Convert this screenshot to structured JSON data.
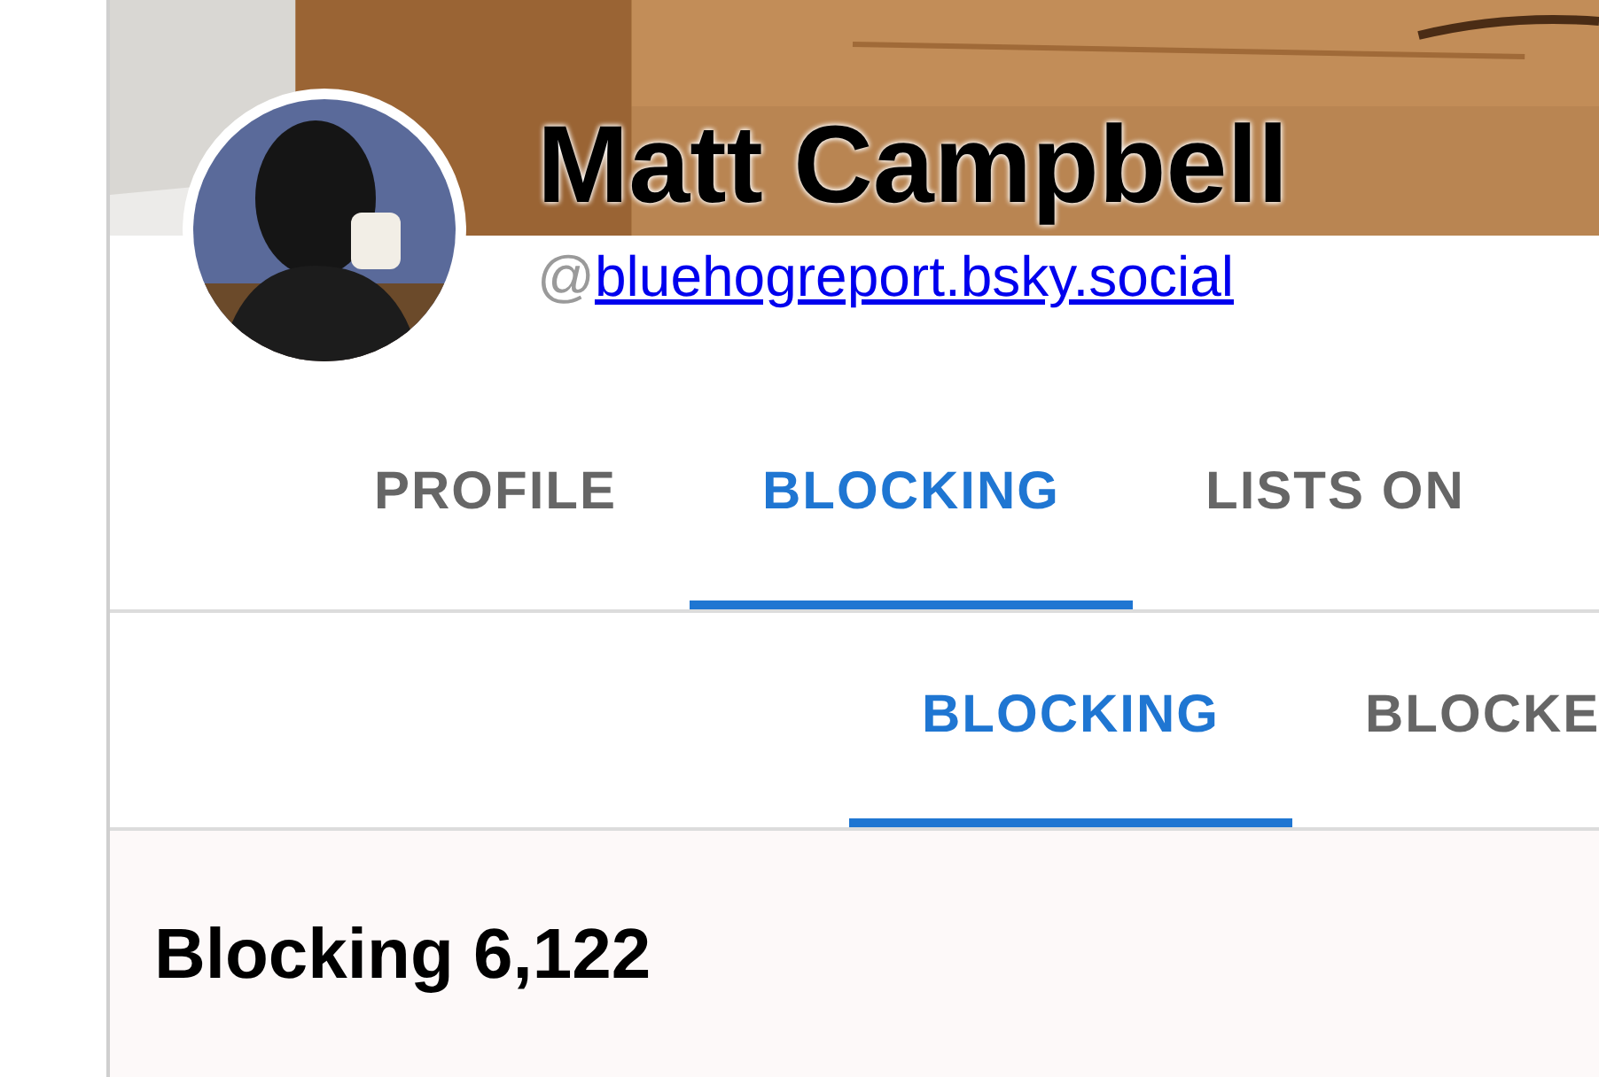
{
  "profile": {
    "name": "Matt Campbell",
    "handle_prefix": "@",
    "handle": "bluehogreport.bsky.social"
  },
  "tabs": [
    {
      "label": "PROFILE",
      "selected": false
    },
    {
      "label": "BLOCKING",
      "selected": true
    },
    {
      "label": "LISTS ON",
      "selected": false
    }
  ],
  "subtabs": [
    {
      "label": "BLOCKING",
      "selected": true
    },
    {
      "label": "BLOCKE",
      "selected": false
    }
  ],
  "section": {
    "title": "Blocking 6,122"
  }
}
